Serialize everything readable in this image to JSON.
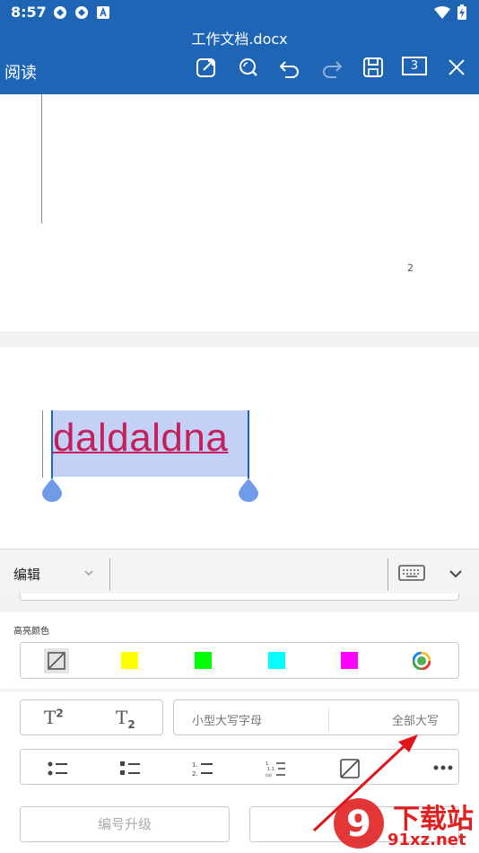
{
  "status_bar": {
    "time": "8:57",
    "battery_icon": "battery-charging-icon",
    "wifi_icon": "wifi-icon",
    "notification_icons": [
      "app-icon",
      "app-icon",
      "a-icon"
    ]
  },
  "title_bar": {
    "doc_title": "工作文档.docx",
    "mode_label": "阅读",
    "page_count": "3",
    "icons": [
      "edit-icon",
      "search-icon",
      "undo-icon",
      "redo-icon",
      "save-icon",
      "close-icon"
    ]
  },
  "document": {
    "page_number": "2",
    "selected_text": "daldaldna",
    "text_color": "#c3205c",
    "selection_color": "#c3d1f7"
  },
  "toolbar": {
    "mode_dropdown": "编辑",
    "keyboard_icon": "keyboard-icon",
    "collapse_icon": "chevron-down-icon"
  },
  "highlight": {
    "label": "高亮颜色",
    "colors": [
      "#ffff00",
      "#00ff00",
      "#00ffff",
      "#ff00ff"
    ]
  },
  "text_style": {
    "superscript": "T",
    "superscript_mark": "2",
    "subscript": "T",
    "subscript_mark": "2",
    "small_caps": "小型大写字母",
    "all_caps": "全部大写"
  },
  "list_buttons": [
    "bullet-list-icon",
    "checklist-icon",
    "numbered-list-icon",
    "multilevel-list-icon",
    "no-list-icon",
    "more-icon"
  ],
  "bottom_buttons": {
    "promote": "编号升级"
  },
  "watermark": {
    "brand": "下载站",
    "url": "91xz.net",
    "logo_digit": "9"
  }
}
